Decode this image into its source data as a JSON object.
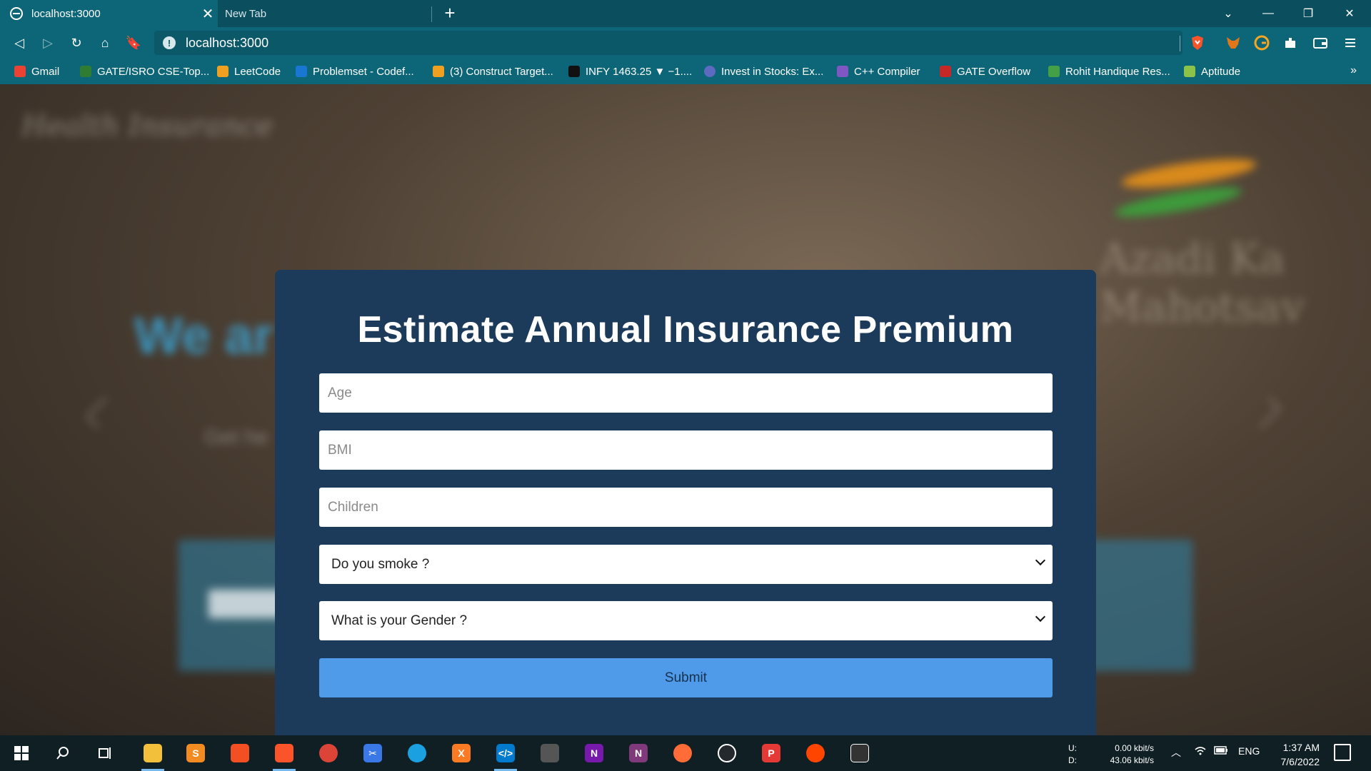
{
  "browser": {
    "tabs": [
      {
        "title": "localhost:3000",
        "close": "✕"
      },
      {
        "title": "New Tab"
      }
    ],
    "new_tab": "+",
    "window_controls": [
      "⌄",
      "—",
      "❐",
      "✕"
    ],
    "url": "localhost:3000",
    "info_icon": "!",
    "nav": {
      "back": "◁",
      "forward": "▷",
      "reload": "↻",
      "home": "⌂",
      "bookmark": "🔖"
    },
    "extensions": [
      "brave-shield-icon",
      "metamask-icon",
      "grammarly-icon",
      "extensions-icon",
      "wallet-icon",
      "menu-icon"
    ],
    "bookmarks": [
      {
        "label": "Gmail",
        "color": "#ea4335"
      },
      {
        "label": "GATE/ISRO CSE-Top...",
        "color": "#2e7d32"
      },
      {
        "label": "LeetCode",
        "color": "#f0a020"
      },
      {
        "label": "Problemset - Codef...",
        "color": "#1976d2"
      },
      {
        "label": "(3) Construct Target...",
        "color": "#f0a020"
      },
      {
        "label": "INFY 1463.25 ▼ −1....",
        "color": "#111111"
      },
      {
        "label": "Invest in Stocks: Ex...",
        "color": "#5c6bc0"
      },
      {
        "label": "C++ Compiler",
        "color": "#7e57c2"
      },
      {
        "label": "GATE Overflow",
        "color": "#c62828"
      },
      {
        "label": "Rohit Handique Res...",
        "color": "#43a047"
      },
      {
        "label": "Aptitude",
        "color": "#8bc34a"
      }
    ],
    "bookmarks_more": "»"
  },
  "background": {
    "brand": "Health Insurance",
    "hero": "We ar",
    "sub": "Get he",
    "logo_text": "Azadi Ka Mahotsav"
  },
  "form": {
    "title": "Estimate Annual Insurance Premium",
    "age_placeholder": "Age",
    "bmi_placeholder": "BMI",
    "children_placeholder": "Children",
    "smoke_select": "Do you smoke ?",
    "gender_select": "What is your Gender ?",
    "submit_label": "Submit"
  },
  "taskbar": {
    "net_up_label": "U:",
    "net_down_label": "D:",
    "net_up": "0.00 kbit/s",
    "net_down": "43.06 kbit/s",
    "language": "ENG",
    "time": "1:37 AM",
    "date": "7/6/2022"
  },
  "colors": {
    "chrome": "#0d6677",
    "modal": "#1c3a5a",
    "submit": "#4f9bea"
  }
}
